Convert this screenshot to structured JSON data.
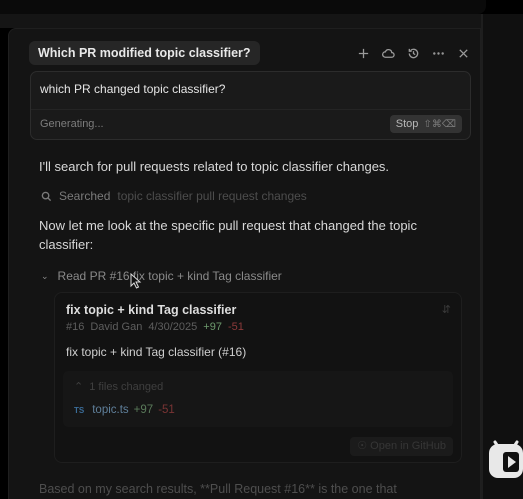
{
  "header": {
    "title": "Which PR modified topic classifier?",
    "icons": [
      "plus-icon",
      "cloud-icon",
      "history-icon",
      "more-icon",
      "close-icon"
    ]
  },
  "input": {
    "text": "which PR changed topic classifier?",
    "status": "Generating...",
    "stop_label": "Stop",
    "stop_shortcut": "⇧⌘⌫"
  },
  "conversation": {
    "intro": "I'll search for pull requests related to topic classifier changes.",
    "searched_label": "Searched",
    "searched_query": "topic classifier pull request changes",
    "followup": "Now let me look at the specific pull request that changed the topic classifier:",
    "read_pr": "Read PR #16 fix topic + kind Tag classifier",
    "bottom": "Based on my search results, **Pull Request #16** is the one that"
  },
  "pr": {
    "title": "fix topic + kind Tag classifier",
    "number": "#16",
    "author": "David Gan",
    "date": "4/30/2025",
    "additions": "+97",
    "deletions": "-51",
    "description": "fix topic + kind Tag classifier (#16)",
    "files_changed": "1 files changed",
    "files": [
      {
        "badge": "TS",
        "name": "topic.ts",
        "additions": "+97",
        "deletions": "-51"
      }
    ],
    "github_button": "Open in GitHub"
  },
  "colors": {
    "panel": "#141414",
    "addition": "#6d9a6d",
    "deletion": "#8c3a3a",
    "ts_badge": "#3b6d99"
  }
}
